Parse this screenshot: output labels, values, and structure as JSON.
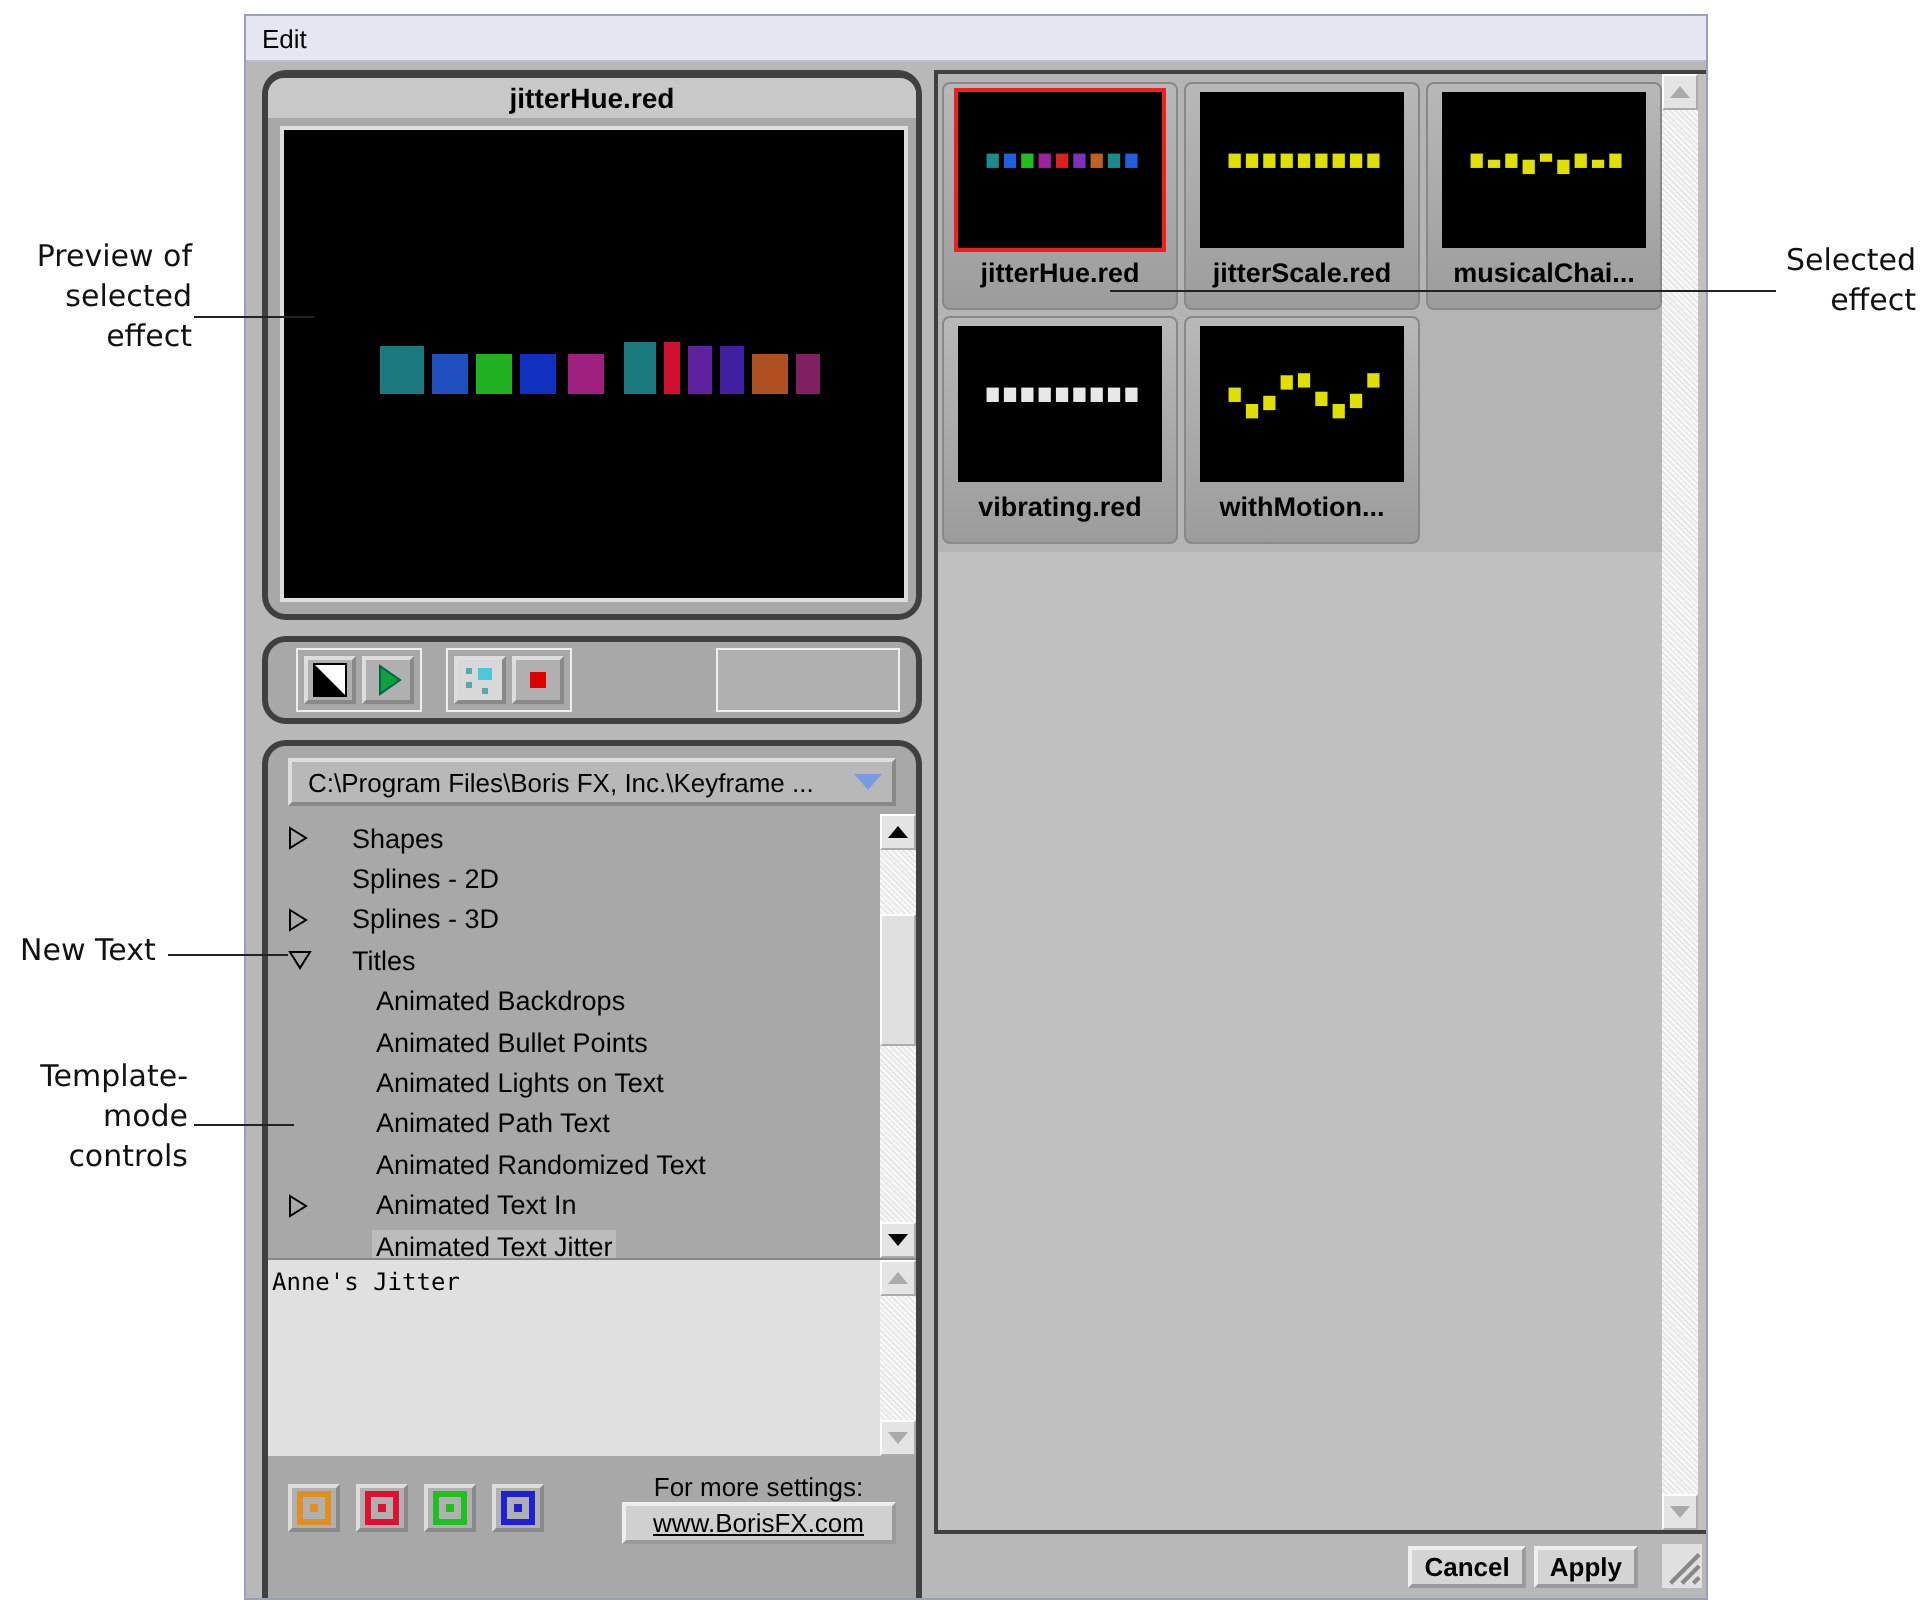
{
  "menu": [
    "Edit"
  ],
  "preview": {
    "title": "jitterHue.red",
    "kind": "picture"
  },
  "path_dropdown": {
    "value": "C:\\Program Files\\Boris FX, Inc.\\Keyframe ..."
  },
  "tree": [
    {
      "label": "Shapes",
      "expanded": false,
      "selected": false
    },
    {
      "label": "Splines - 2D",
      "selected": false
    },
    {
      "label": "Splines - 3D",
      "expanded": false,
      "selected": false
    },
    {
      "label": "Titles",
      "expanded": true,
      "selected": false,
      "children": [
        {
          "label": "Animated Backdrops",
          "selected": false
        },
        {
          "label": "Animated Bullet Points",
          "selected": false
        },
        {
          "label": "Animated Lights on Text",
          "selected": false
        },
        {
          "label": "Animated Path Text",
          "selected": false
        },
        {
          "label": "Animated Randomized Text",
          "selected": false
        },
        {
          "label": "Animated Text In",
          "expanded": false,
          "selected": false
        },
        {
          "label": "Animated Text Jitter",
          "selected": true
        }
      ]
    }
  ],
  "text_field": {
    "value": "Anne's Jitter"
  },
  "more_settings": {
    "label": "For more settings:",
    "link": "www.BorisFX.com"
  },
  "effects": [
    {
      "name": "jitterHue.red",
      "selected": true
    },
    {
      "name": "jitterScale.red",
      "selected": false
    },
    {
      "name": "musicalChai...",
      "selected": false
    },
    {
      "name": "vibrating.red",
      "selected": false
    },
    {
      "name": "withMotion...",
      "selected": false
    }
  ],
  "buttons": [
    "Cancel",
    "Apply"
  ],
  "annotations": [
    {
      "text": "Preview of selected effect"
    },
    {
      "text": "Selected effect"
    },
    {
      "text": "New Text"
    },
    {
      "text": "Template-mode controls"
    }
  ]
}
